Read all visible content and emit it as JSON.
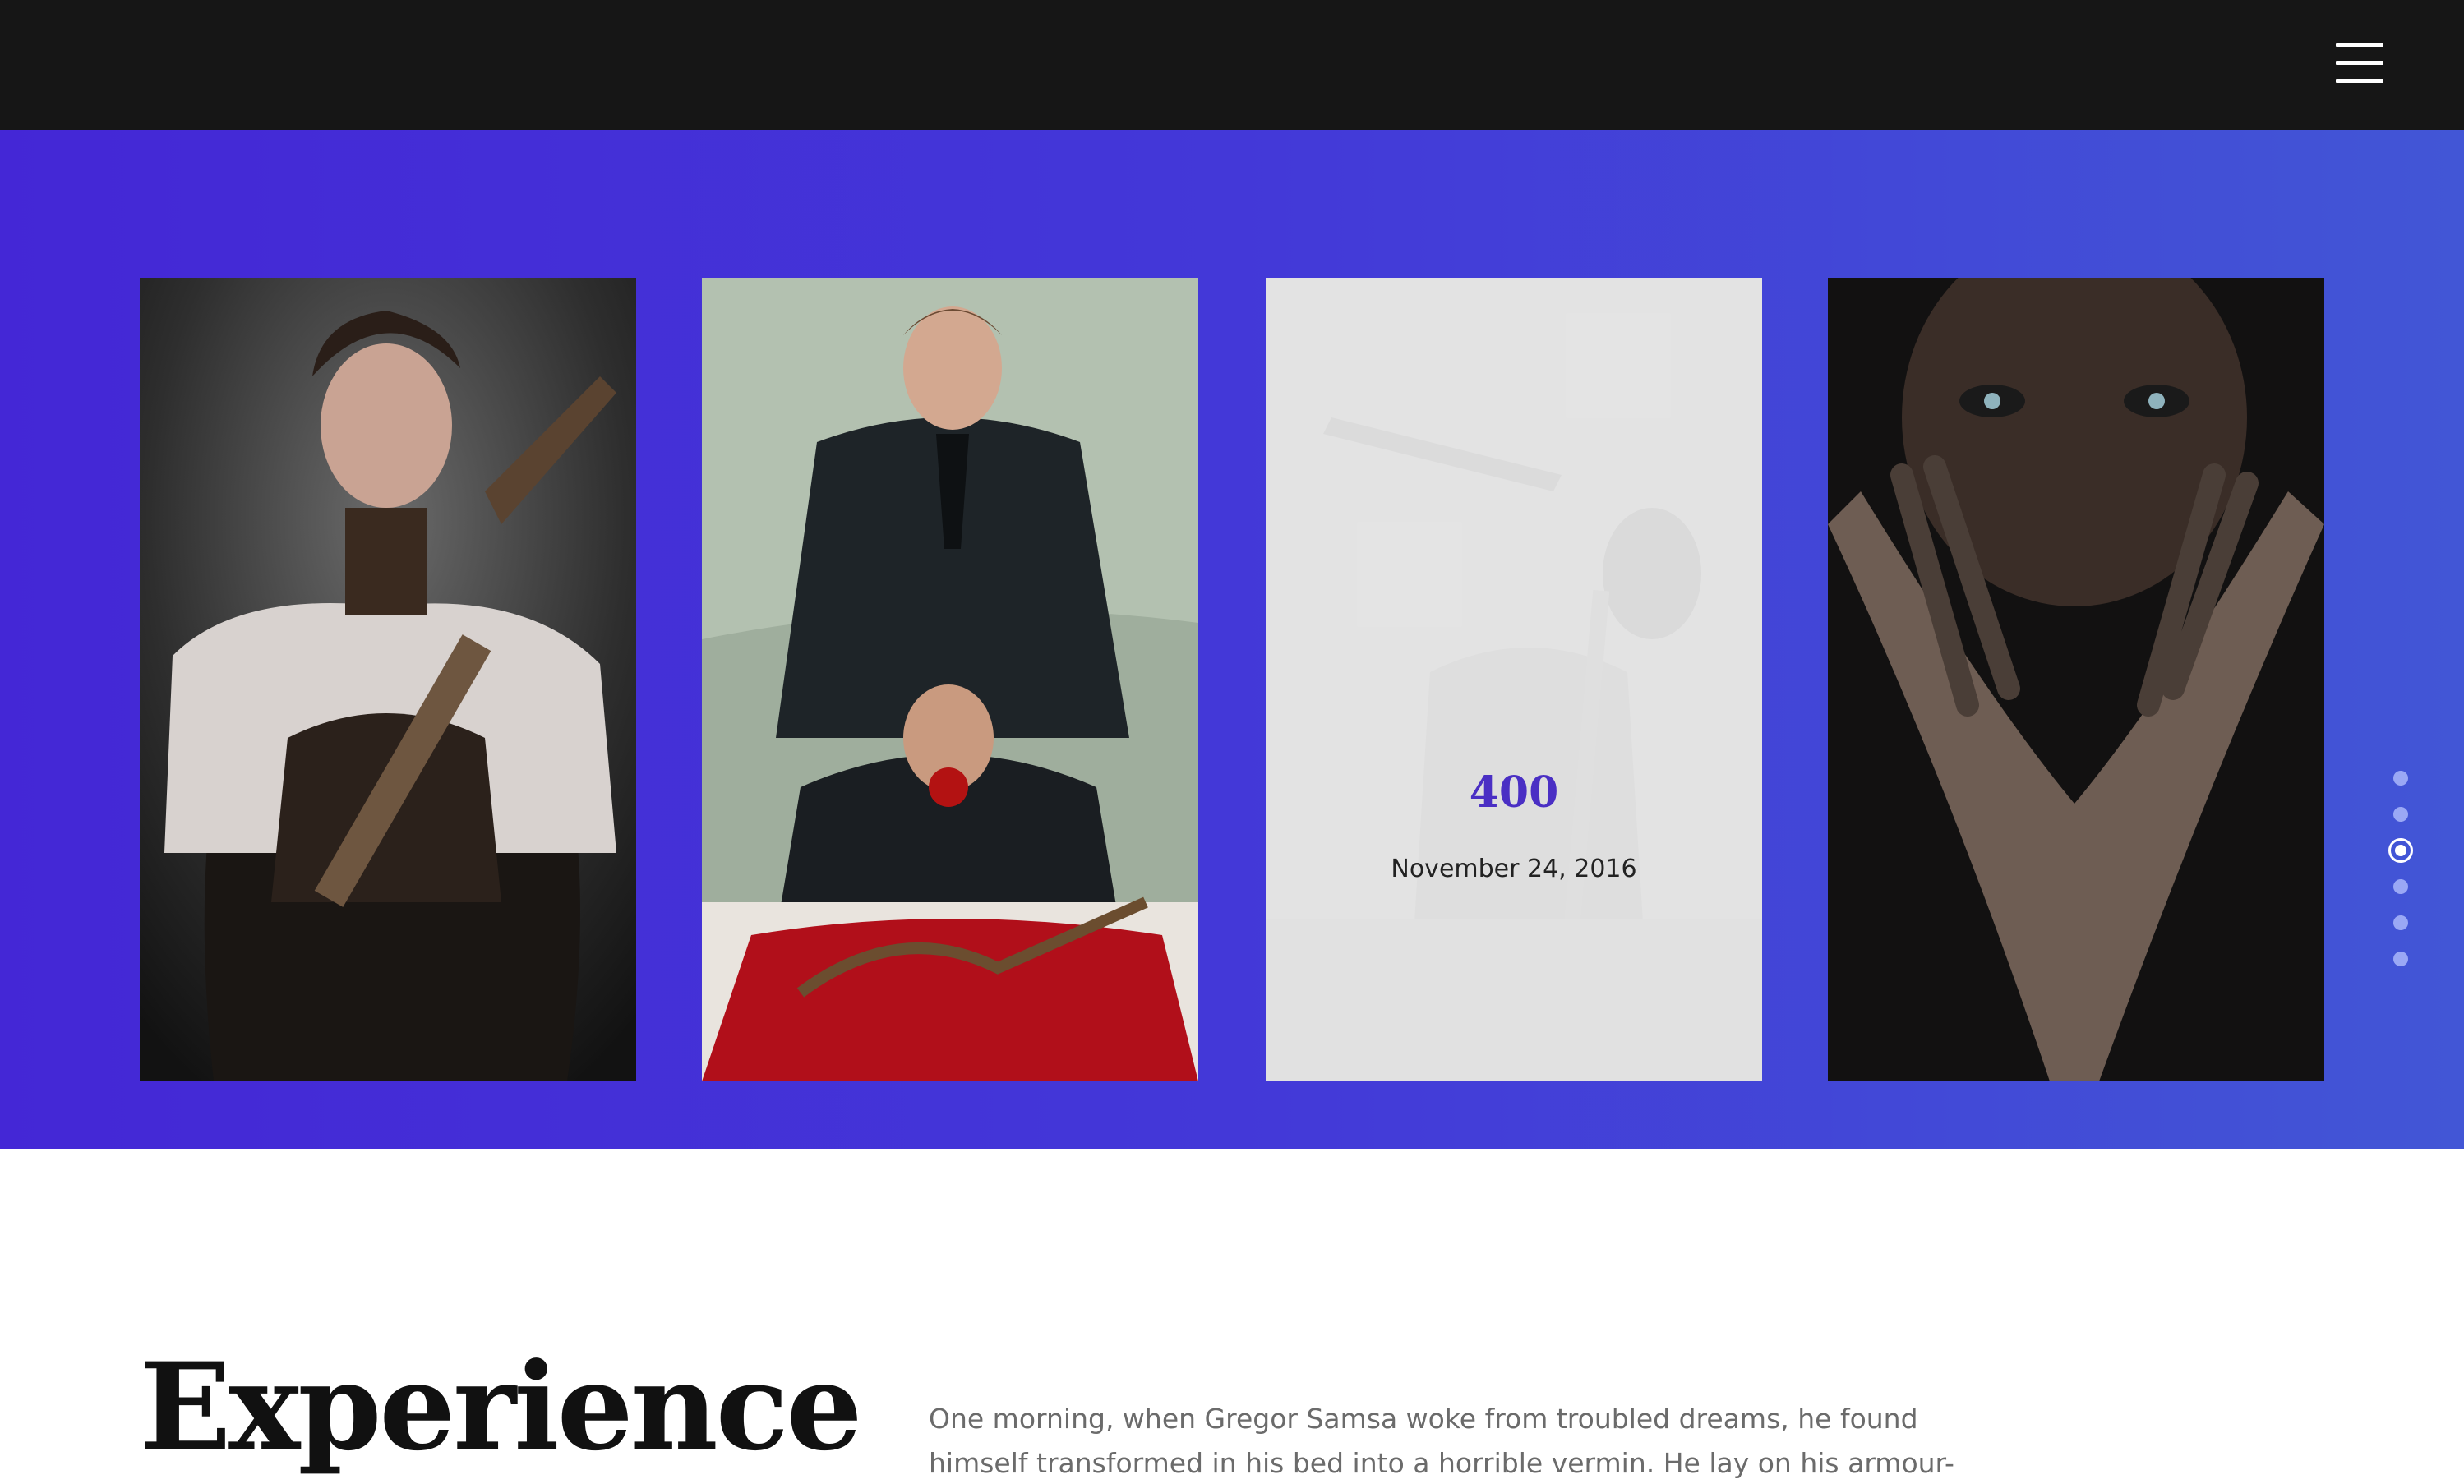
{
  "header": {
    "menu_icon": "hamburger-menu-icon"
  },
  "colors": {
    "header_bg": "#161616",
    "band_accent": "#4427d6",
    "number_accent": "#4a2fc4"
  },
  "gallery": {
    "cards": [
      {
        "image": "steampunk-woman-image"
      },
      {
        "image": "two-men-in-suits-image"
      },
      {
        "image": "warrior-with-sword-image",
        "number": "400",
        "date": "November 24, 2016"
      },
      {
        "image": "painted-face-woman-image"
      }
    ],
    "pager": {
      "count": 6,
      "active_index": 2
    }
  },
  "experience": {
    "title": "Experience",
    "text": "One morning, when Gregor Samsa woke from troubled dreams, he found himself transformed in his bed into a horrible vermin. He lay on his armour-like back, and if"
  }
}
